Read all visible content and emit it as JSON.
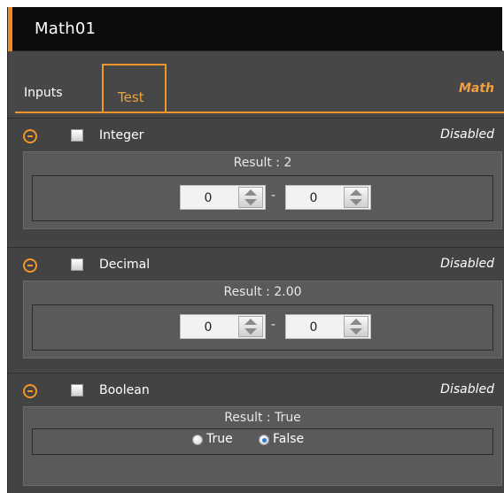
{
  "window": {
    "title": "Math01"
  },
  "tabs": [
    {
      "label": "Inputs",
      "active": false
    },
    {
      "label": "Test",
      "active": true
    }
  ],
  "header_right_label": "Math",
  "accent_color": "#f0962a",
  "sections": [
    {
      "name": "Integer",
      "status": "Disabled",
      "checked": false,
      "result": "Result : 2",
      "inputs": {
        "left": "0",
        "right": "0",
        "separator": "-"
      }
    },
    {
      "name": "Decimal",
      "status": "Disabled",
      "checked": false,
      "result": "Result : 2.00",
      "inputs": {
        "left": "0",
        "right": "0",
        "separator": "-"
      }
    },
    {
      "name": "Boolean",
      "status": "Disabled",
      "checked": false,
      "result": "Result : True",
      "options": [
        {
          "label": "True",
          "selected": false
        },
        {
          "label": "False",
          "selected": true
        }
      ]
    }
  ]
}
